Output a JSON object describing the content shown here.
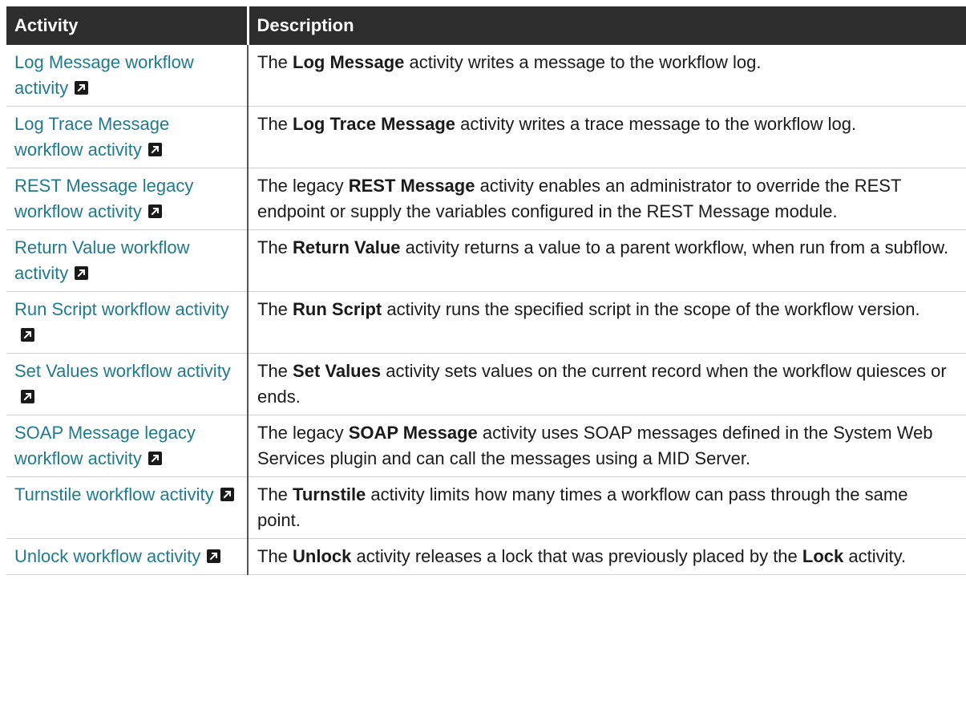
{
  "header": {
    "activity": "Activity",
    "description": "Description"
  },
  "rows": [
    {
      "link": "Log Message workflow activity",
      "pre": "The ",
      "bold": "Log Message",
      "post": " activity writes a message to the workflow log.",
      "bold2": "",
      "post2": ""
    },
    {
      "link": "Log Trace Message workflow activity",
      "pre": "The ",
      "bold": "Log Trace Message",
      "post": " activity writes a trace message to the workflow log.",
      "bold2": "",
      "post2": ""
    },
    {
      "link": "REST Message legacy workflow activity",
      "pre": "The legacy ",
      "bold": "REST Message",
      "post": " activity enables an administrator to override the REST endpoint or supply the variables configured in the REST Message module.",
      "bold2": "",
      "post2": ""
    },
    {
      "link": "Return Value workflow activity",
      "pre": "The ",
      "bold": "Return Value",
      "post": " activity returns a value to a parent workflow, when run from a subflow.",
      "bold2": "",
      "post2": ""
    },
    {
      "link": "Run Script workflow activity",
      "pre": "The ",
      "bold": "Run Script",
      "post": " activity runs the specified script in the scope of the workflow version.",
      "bold2": "",
      "post2": ""
    },
    {
      "link": "Set Values workflow activity",
      "pre": "The ",
      "bold": "Set Values",
      "post": " activity sets values on the current record when the workflow quiesces or ends.",
      "bold2": "",
      "post2": ""
    },
    {
      "link": "SOAP Message legacy workflow activity",
      "pre": "The legacy ",
      "bold": "SOAP Message",
      "post": " activity uses SOAP messages defined in the System Web Services plugin and can call the messages using a MID Server.",
      "bold2": "",
      "post2": ""
    },
    {
      "link": "Turnstile workflow activity",
      "pre": "The ",
      "bold": "Turnstile",
      "post": " activity limits how many times a workflow can pass through the same point.",
      "bold2": "",
      "post2": ""
    },
    {
      "link": "Unlock workflow activity",
      "pre": "The ",
      "bold": "Unlock",
      "post": " activity releases a lock that was previously placed by the ",
      "bold2": "Lock",
      "post2": " activity."
    }
  ],
  "icons": {
    "external_link": "external-link-icon"
  },
  "colors": {
    "header_bg": "#2d2d2d",
    "link": "#1f7a8c"
  }
}
